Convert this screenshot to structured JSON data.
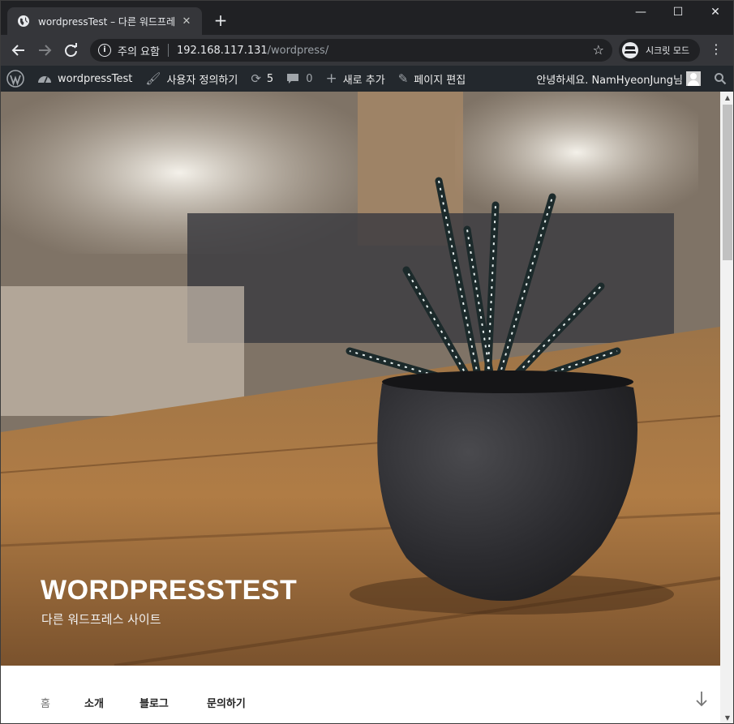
{
  "browser": {
    "tab_title": "wordpressTest – 다른 워드프레스",
    "tab_close": "✕",
    "new_tab": "+",
    "minimize": "—",
    "maximize": "☐",
    "close": "✕",
    "omnibox": {
      "security_label": "주의 요함",
      "host": "192.168.117.131",
      "path": "/wordpress/"
    },
    "incognito_label": "시크릿 모드"
  },
  "admin_bar": {
    "site_name": "wordpressTest",
    "customize": "사용자 정의하기",
    "updates_count": "5",
    "comments_count": "0",
    "new_content": "새로 추가",
    "edit_page": "페이지 편집",
    "greeting": "안녕하세요. NamHyeonJung님"
  },
  "header": {
    "site_title": "WORDPRESSTEST",
    "site_description": "다른 워드프레스 사이트"
  },
  "navigation": {
    "items": [
      {
        "label": "홈"
      },
      {
        "label": "소개"
      },
      {
        "label": "블로그"
      },
      {
        "label": "문의하기"
      }
    ]
  },
  "icons": {
    "back": "arrow-left-icon",
    "forward": "arrow-right-icon",
    "reload": "reload-icon",
    "star": "star-icon",
    "wordpress": "wordpress-logo-icon",
    "search": "search-icon",
    "scroll_down": "arrow-down-icon"
  },
  "colors": {
    "admin_bar_bg": "#23282d",
    "browser_frame": "#202124",
    "toolbar": "#35363a"
  }
}
